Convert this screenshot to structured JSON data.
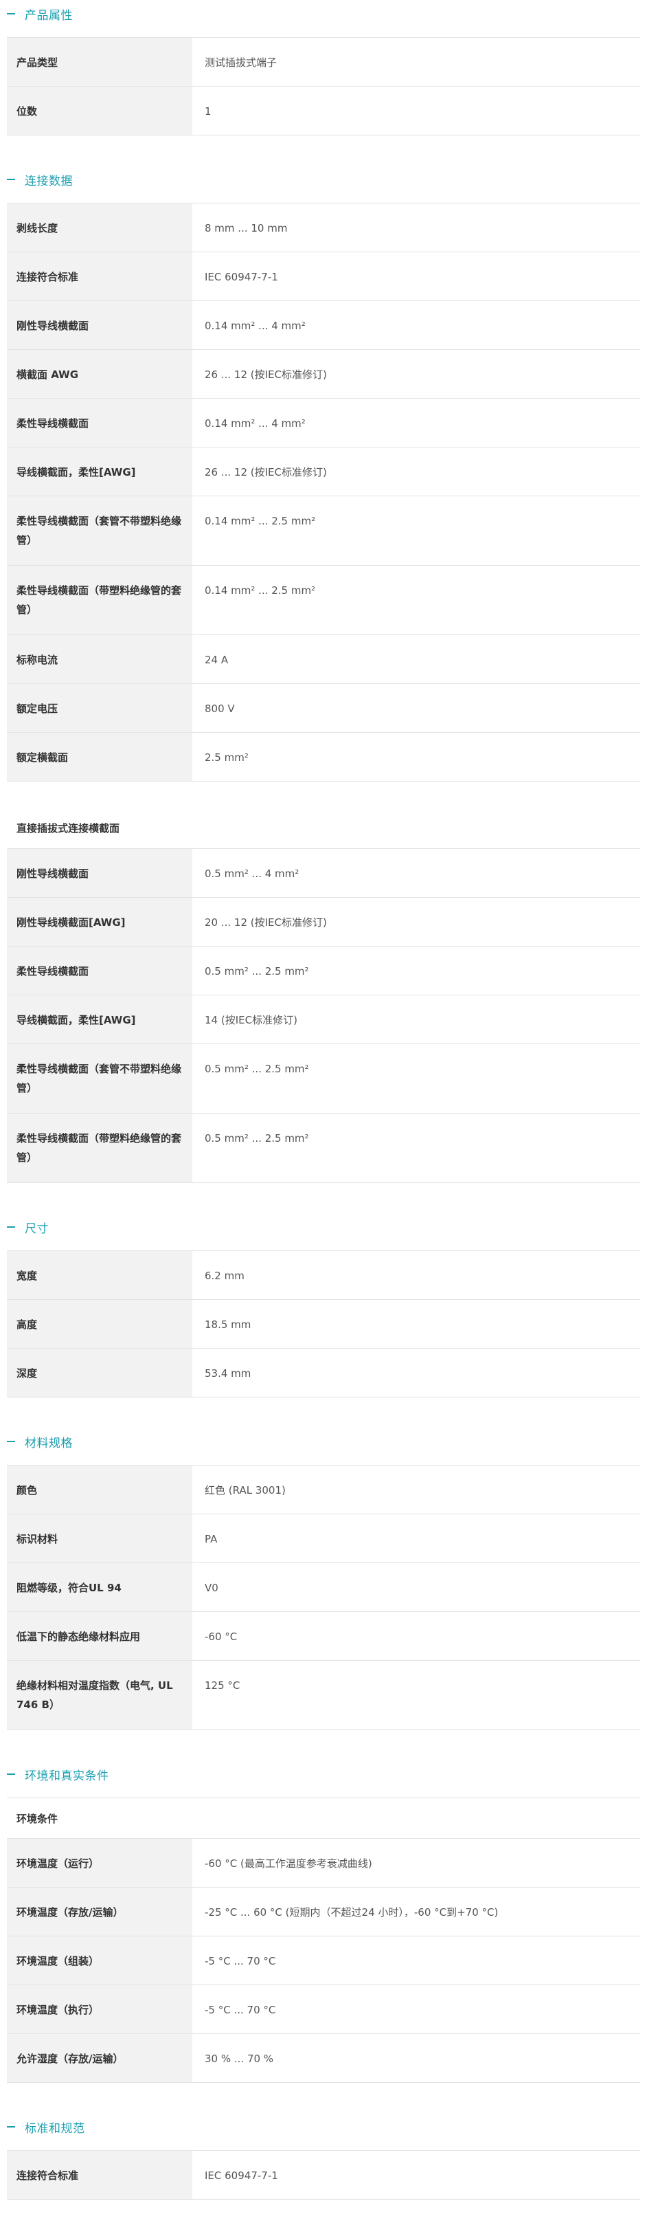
{
  "sections": [
    {
      "title": "产品属性",
      "rows": [
        {
          "label": "产品类型",
          "value": "测试插拔式端子"
        },
        {
          "label": "位数",
          "value": "1"
        }
      ]
    },
    {
      "title": "连接数据",
      "rows": [
        {
          "label": "剥线长度",
          "value": "8 mm ... 10 mm"
        },
        {
          "label": "连接符合标准",
          "value": "IEC 60947-7-1"
        },
        {
          "label": "刚性导线横截面",
          "value": "0.14 mm² ... 4 mm²"
        },
        {
          "label": "横截面 AWG",
          "value": "26 ... 12 (按IEC标准修订)"
        },
        {
          "label": "柔性导线横截面",
          "value": "0.14 mm² ... 4 mm²"
        },
        {
          "label": "导线横截面，柔性[AWG]",
          "value": "26 ... 12 (按IEC标准修订)"
        },
        {
          "label": "柔性导线横截面（套管不带塑料绝缘管）",
          "value": "0.14 mm² ... 2.5 mm²"
        },
        {
          "label": "柔性导线横截面（带塑料绝缘管的套管）",
          "value": "0.14 mm² ... 2.5 mm²"
        },
        {
          "label": "标称电流",
          "value": "24 A"
        },
        {
          "label": "额定电压",
          "value": "800 V"
        },
        {
          "label": "额定横截面",
          "value": "2.5 mm²"
        }
      ],
      "subgroup": {
        "title": "直接插拔式连接横截面",
        "rows": [
          {
            "label": "刚性导线横截面",
            "value": "0.5 mm² ... 4 mm²"
          },
          {
            "label": "刚性导线横截面[AWG]",
            "value": "20 ... 12 (按IEC标准修订)"
          },
          {
            "label": "柔性导线横截面",
            "value": "0.5 mm² ... 2.5 mm²"
          },
          {
            "label": "导线横截面，柔性[AWG]",
            "value": "14 (按IEC标准修订)"
          },
          {
            "label": "柔性导线横截面（套管不带塑料绝缘管）",
            "value": "0.5 mm² ... 2.5 mm²"
          },
          {
            "label": "柔性导线横截面（带塑料绝缘管的套管）",
            "value": "0.5 mm² ... 2.5 mm²"
          }
        ]
      }
    },
    {
      "title": "尺寸",
      "rows": [
        {
          "label": "宽度",
          "value": "6.2 mm"
        },
        {
          "label": "高度",
          "value": "18.5 mm"
        },
        {
          "label": "深度",
          "value": "53.4 mm"
        }
      ]
    },
    {
      "title": "材料规格",
      "rows": [
        {
          "label": "颜色",
          "value": "红色 (RAL 3001)"
        },
        {
          "label": "标识材料",
          "value": "PA"
        },
        {
          "label": "阻燃等级，符合UL 94",
          "value": "V0"
        },
        {
          "label": "低温下的静态绝缘材料应用",
          "value": "-60 °C"
        },
        {
          "label": "绝缘材料相对温度指数（电气, UL 746 B）",
          "value": "125 °C"
        }
      ]
    },
    {
      "title": "环境和真实条件",
      "subheading": "环境条件",
      "rows": [
        {
          "label": "环境温度（运行）",
          "value": "-60 °C (最高工作温度参考衰减曲线)"
        },
        {
          "label": "环境温度（存放/运输）",
          "value": "-25 °C ... 60 °C (短期内（不超过24 小时），-60 °C到+70 °C)"
        },
        {
          "label": "环境温度（组装）",
          "value": "-5 °C ... 70 °C"
        },
        {
          "label": "环境温度（执行）",
          "value": "-5 °C ... 70 °C"
        },
        {
          "label": "允许湿度（存放/运输）",
          "value": "30 % ... 70 %"
        }
      ]
    },
    {
      "title": "标准和规范",
      "rows": [
        {
          "label": "连接符合标准",
          "value": "IEC 60947-7-1"
        }
      ]
    }
  ]
}
